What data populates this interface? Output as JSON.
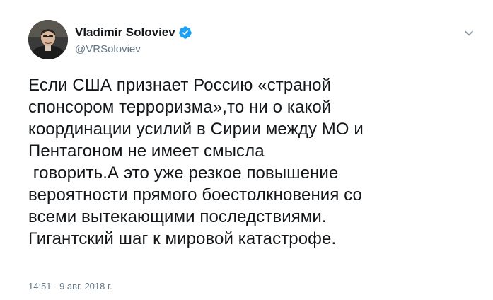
{
  "author": {
    "display_name": "Vladimir Soloviev",
    "handle": "@VRSoloviev",
    "verified_icon": "verified-badge-icon",
    "brand_color": "#1da1f2"
  },
  "tweet": {
    "lines": [
      "Если США признает Россию «страной",
      "спонсором терроризма»,то ни о какой",
      "координации усилий в Сирии между МО и",
      "Пентагоном не имеет смысла",
      " говорить.А это уже резкое повышение",
      "вероятности прямого боестолкновения со",
      "всеми вытекающими последствиями.",
      "Гигантский шаг к мировой катастрофе."
    ],
    "timestamp": "14:51 - 9 авг. 2018 г."
  },
  "icons": {
    "caret": "chevron-down-icon",
    "avatar": "avatar"
  }
}
